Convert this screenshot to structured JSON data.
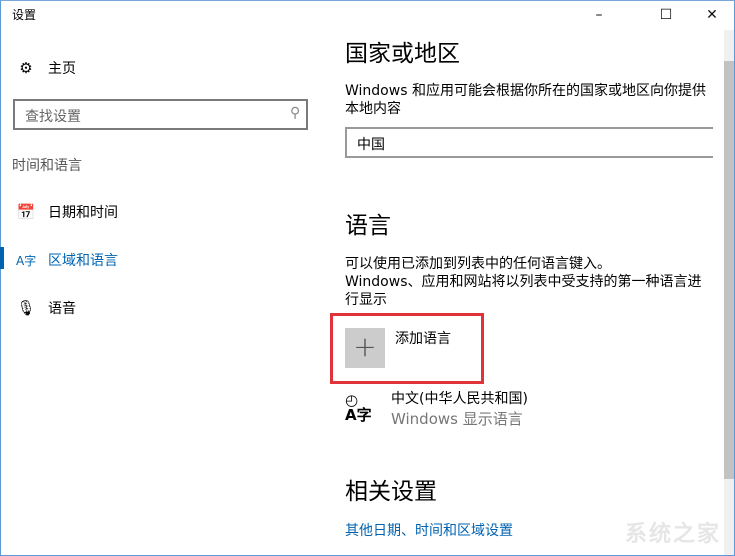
{
  "window": {
    "title": "设置",
    "minimize": "–",
    "maximize": "☐",
    "close": "✕"
  },
  "sidebar": {
    "home": "主页",
    "search_placeholder": "查找设置",
    "section": "时间和语言",
    "items": [
      {
        "label": "日期和时间",
        "active": false
      },
      {
        "label": "区域和语言",
        "active": true
      },
      {
        "label": "语音",
        "active": false
      }
    ]
  },
  "main": {
    "region": {
      "heading": "国家或地区",
      "description": "Windows 和应用可能会根据你所在的国家或地区向你提供本地内容",
      "selected": "中国"
    },
    "language": {
      "heading": "语言",
      "line1": "可以使用已添加到列表中的任何语言键入。",
      "line2": "Windows、应用和网站将以列表中受支持的第一种语言进行显示",
      "add_label": "添加语言",
      "plus": "+",
      "items": [
        {
          "name": "中文(中华人民共和国)",
          "sub": "Windows 显示语言"
        }
      ]
    },
    "related": {
      "heading": "相关设置",
      "link": "其他日期、时间和区域设置"
    }
  },
  "watermark": "系统之家",
  "colors": {
    "accent": "#0063b1",
    "highlight": "#e0333a"
  }
}
